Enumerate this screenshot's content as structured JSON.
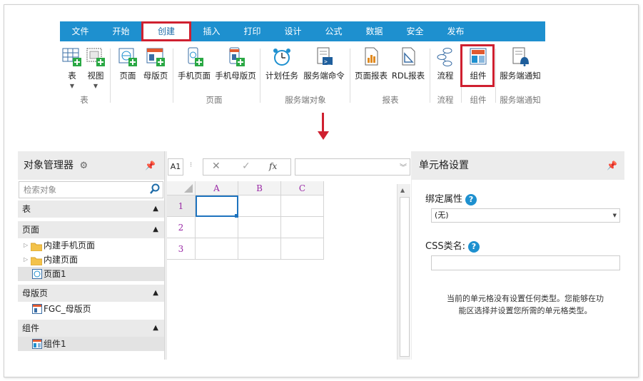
{
  "ribbon": {
    "tabs": [
      "文件",
      "开始",
      "创建",
      "插入",
      "打印",
      "设计",
      "公式",
      "数据",
      "安全",
      "发布"
    ],
    "active_tab": "创建",
    "buttons": {
      "table": "表",
      "view": "视图",
      "page": "页面",
      "master_page": "母版页",
      "mobile_page": "手机页面",
      "mobile_master": "手机母版页",
      "scheduled_task": "计划任务",
      "server_command": "服务端命令",
      "page_report": "页面报表",
      "rdl_report": "RDL报表",
      "workflow": "流程",
      "component": "组件",
      "server_notify": "服务端通知"
    },
    "groups": {
      "table": "表",
      "page": "页面",
      "server_object": "服务端对象",
      "report": "报表",
      "workflow": "流程",
      "component": "组件",
      "server_notify": "服务端通知"
    }
  },
  "object_manager": {
    "title": "对象管理器",
    "search_placeholder": "检索对象",
    "sections": {
      "table": "表",
      "page": "页面",
      "master": "母版页",
      "component": "组件"
    },
    "page_items": [
      "内建手机页面",
      "内建页面",
      "页面1"
    ],
    "master_items": [
      "FGC_母版页"
    ],
    "component_items": [
      "组件1"
    ]
  },
  "sheet": {
    "cell_ref": "A1",
    "fx": "fx",
    "columns": [
      "A",
      "B",
      "C"
    ],
    "rows": [
      "1",
      "2",
      "3"
    ]
  },
  "cell_settings": {
    "title": "单元格设置",
    "bind_label": "绑定属性",
    "bind_value": "(无)",
    "css_label": "CSS类名:",
    "message_line1": "当前的单元格没有设置任何类型。您能够在功",
    "message_line2": "能区选择并设置您所需的单元格类型。"
  },
  "colors": {
    "accent": "#1E90CF",
    "highlight": "#CF2030"
  }
}
